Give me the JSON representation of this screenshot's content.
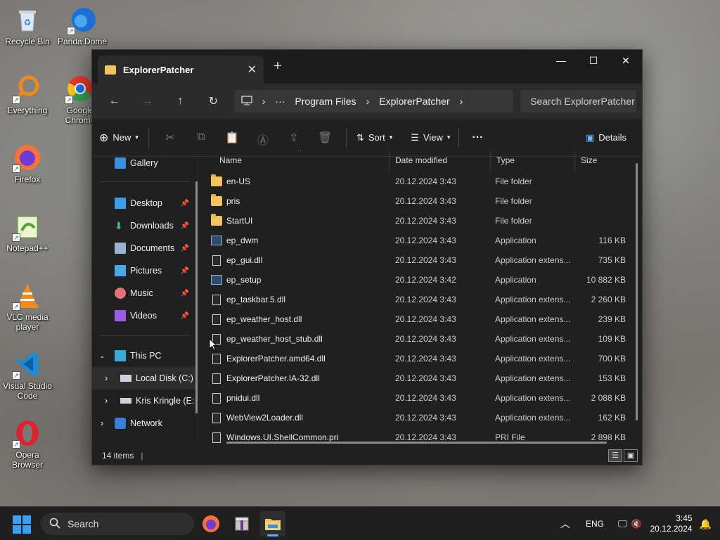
{
  "desktop": {
    "icons": [
      {
        "label": "Recycle Bin"
      },
      {
        "label": "Panda Dome"
      },
      {
        "label": "Everything"
      },
      {
        "label": "Google Chrome"
      },
      {
        "label": "Firefox"
      },
      {
        "label": "Notepad++"
      },
      {
        "label": "VLC media player"
      },
      {
        "label": "Visual Studio Code"
      },
      {
        "label": "Opera Browser"
      }
    ]
  },
  "window": {
    "tab_title": "ExplorerPatcher",
    "tab_close": "✕",
    "new_tab": "+",
    "controls": {
      "minimize": "—",
      "maximize": "☐",
      "close": "✕"
    },
    "address": {
      "back": "←",
      "forward": "→",
      "up": "↑",
      "refresh": "↻",
      "crumbs": [
        "Program Files",
        "ExplorerPatcher"
      ],
      "ellipsis": "···",
      "search_placeholder": "Search ExplorerPatcher"
    },
    "toolbar": {
      "new_label": "New",
      "sort_label": "Sort",
      "view_label": "View",
      "more_label": "···",
      "details_label": "Details"
    },
    "sidebar": {
      "gallery": "Gallery",
      "quick_access": [
        {
          "label": "Desktop"
        },
        {
          "label": "Downloads"
        },
        {
          "label": "Documents"
        },
        {
          "label": "Pictures"
        },
        {
          "label": "Music"
        },
        {
          "label": "Videos"
        }
      ],
      "this_pc": "This PC",
      "local_disk": "Local Disk (C:)",
      "kris_drive": "Kris Kringle (E:",
      "network": "Network"
    },
    "columns": {
      "name": "Name",
      "date": "Date modified",
      "type": "Type",
      "size": "Size"
    },
    "files": [
      {
        "name": "en-US",
        "date": "20.12.2024 3:43",
        "type": "File folder",
        "size": "",
        "kind": "folder"
      },
      {
        "name": "pris",
        "date": "20.12.2024 3:43",
        "type": "File folder",
        "size": "",
        "kind": "folder"
      },
      {
        "name": "StartUI",
        "date": "20.12.2024 3:43",
        "type": "File folder",
        "size": "",
        "kind": "folder"
      },
      {
        "name": "ep_dwm",
        "date": "20.12.2024 3:43",
        "type": "Application",
        "size": "116 KB",
        "kind": "app"
      },
      {
        "name": "ep_gui.dll",
        "date": "20.12.2024 3:43",
        "type": "Application extens...",
        "size": "735 KB",
        "kind": "dll"
      },
      {
        "name": "ep_setup",
        "date": "20.12.2024 3:42",
        "type": "Application",
        "size": "10 882 KB",
        "kind": "app"
      },
      {
        "name": "ep_taskbar.5.dll",
        "date": "20.12.2024 3:43",
        "type": "Application extens...",
        "size": "2 260 KB",
        "kind": "dll"
      },
      {
        "name": "ep_weather_host.dll",
        "date": "20.12.2024 3:43",
        "type": "Application extens...",
        "size": "239 KB",
        "kind": "dll"
      },
      {
        "name": "ep_weather_host_stub.dll",
        "date": "20.12.2024 3:43",
        "type": "Application extens...",
        "size": "109 KB",
        "kind": "dll"
      },
      {
        "name": "ExplorerPatcher.amd64.dll",
        "date": "20.12.2024 3:43",
        "type": "Application extens...",
        "size": "700 KB",
        "kind": "dll"
      },
      {
        "name": "ExplorerPatcher.IA-32.dll",
        "date": "20.12.2024 3:43",
        "type": "Application extens...",
        "size": "153 KB",
        "kind": "dll"
      },
      {
        "name": "pnidui.dll",
        "date": "20.12.2024 3:43",
        "type": "Application extens...",
        "size": "2 088 KB",
        "kind": "dll"
      },
      {
        "name": "WebView2Loader.dll",
        "date": "20.12.2024 3:43",
        "type": "Application extens...",
        "size": "162 KB",
        "kind": "dll"
      },
      {
        "name": "Windows.UI.ShellCommon.pri",
        "date": "20.12.2024 3:43",
        "type": "PRI File",
        "size": "2 898 KB",
        "kind": "dll"
      }
    ],
    "status": "14 items"
  },
  "taskbar": {
    "search_label": "Search",
    "lang": "ENG",
    "time": "3:45",
    "date": "20.12.2024"
  }
}
